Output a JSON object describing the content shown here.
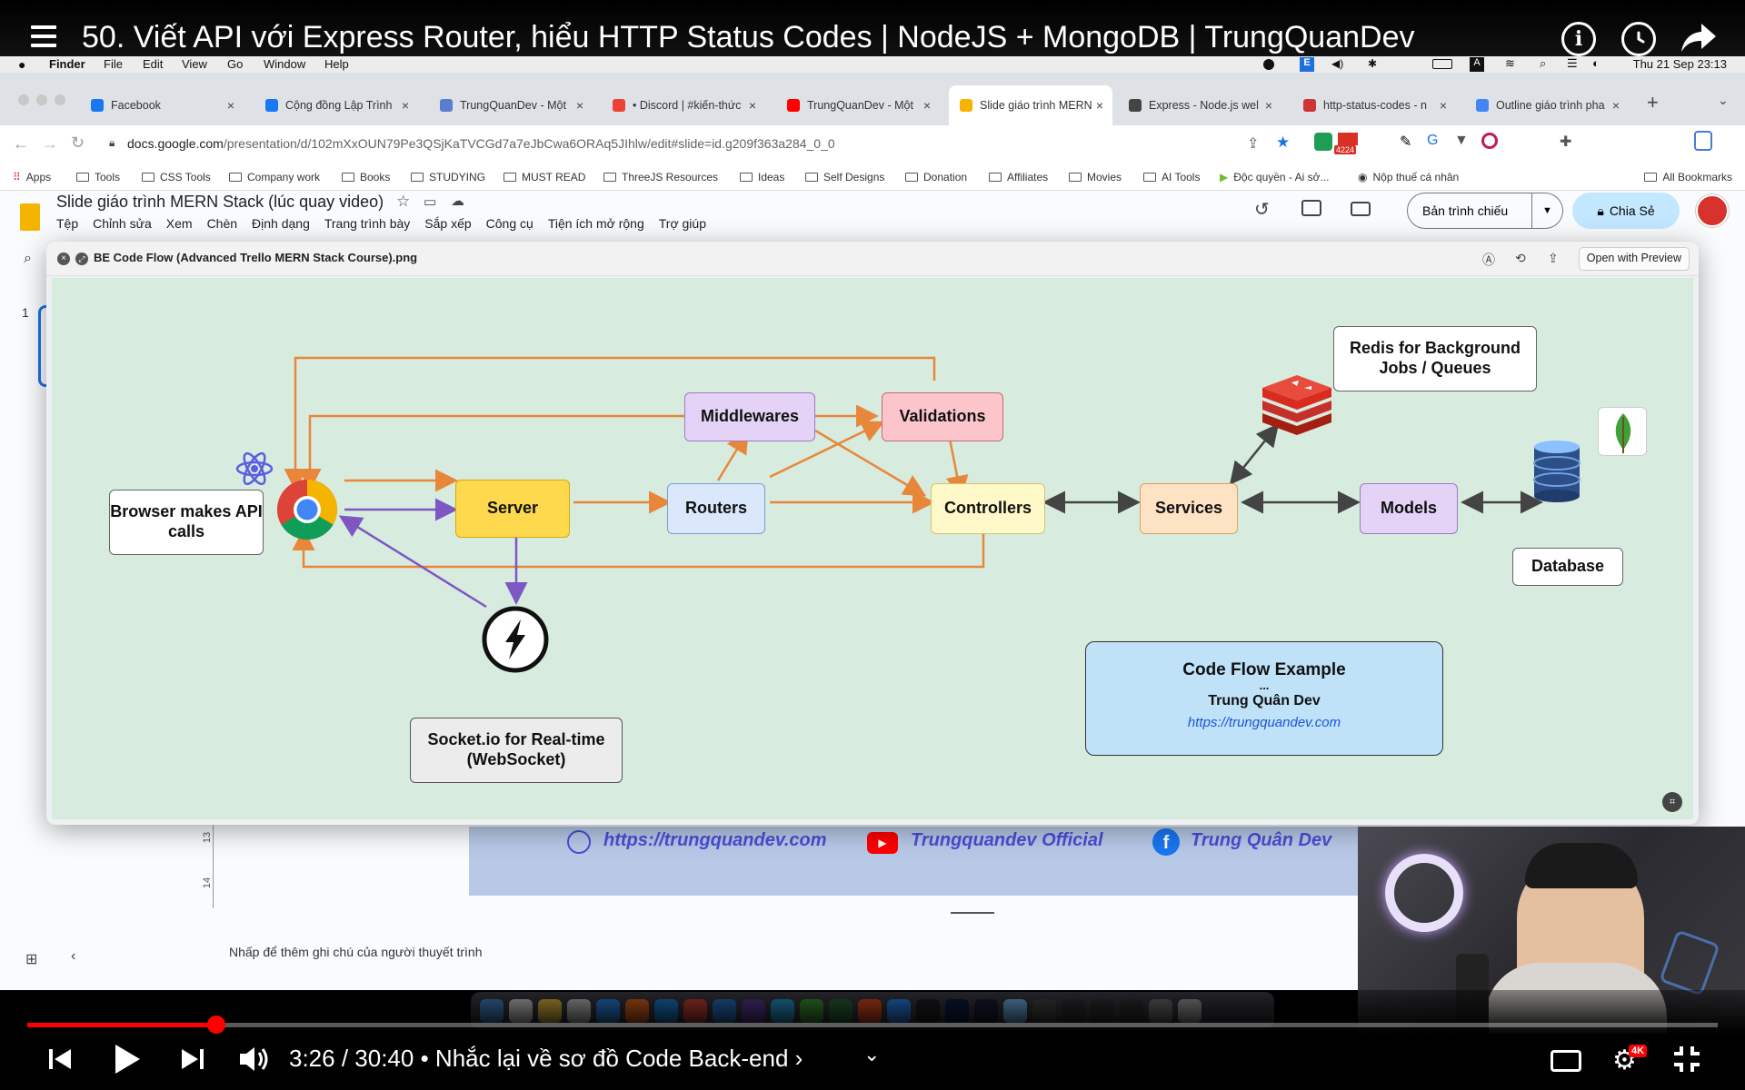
{
  "youtube": {
    "video_title": "50. Viết API với Express Router, hiểu HTTP Status Codes | NodeJS + MongoDB | TrungQuanDev",
    "time_current": "3:26",
    "time_total": "30:40",
    "chapter": "Nhắc lại về sơ đồ Code Back-end",
    "progress": 0.112,
    "quality_badge": "4K"
  },
  "mac_menubar": {
    "app": "Finder",
    "items": [
      "File",
      "Edit",
      "View",
      "Go",
      "Window",
      "Help"
    ],
    "clock": "Thu 21 Sep  23:13"
  },
  "browser": {
    "tabs": [
      {
        "label": "Facebook",
        "color": "#1877f2"
      },
      {
        "label": "Cộng đồng Lập Trình",
        "color": "#1877f2"
      },
      {
        "label": "TrungQuanDev - Một",
        "color": "#5b7ccf"
      },
      {
        "label": "• Discord | #kiến-thức",
        "color": "#ea4335"
      },
      {
        "label": "TrungQuanDev - Một",
        "color": "#ff0000"
      },
      {
        "label": "Slide giáo trình MERN",
        "color": "#f4b400",
        "active": true
      },
      {
        "label": "Express - Node.js wel",
        "color": "#444444"
      },
      {
        "label": "http-status-codes - n",
        "color": "#cc3534"
      },
      {
        "label": "Outline giáo trình pha",
        "color": "#4285f4"
      }
    ],
    "url_host": "docs.google.com",
    "url_path": "/presentation/d/102mXxOUN79Pe3QSjKaTVCGd7a7eJbCwa6ORAq5JIhlw/edit#slide=id.g209f363a284_0_0",
    "extension_badge": "4224",
    "bookmarks": [
      "Apps",
      "Tools",
      "CSS Tools",
      "Company work",
      "Books",
      "STUDYING",
      "MUST READ",
      "ThreeJS Resources",
      "Ideas",
      "Self Designs",
      "Donation",
      "Affiliates",
      "Movies",
      "AI Tools",
      "Độc quyền - Ai sở...",
      "Nộp thuế cá nhân"
    ],
    "all_bookmarks": "All Bookmarks"
  },
  "slides": {
    "doc_title": "Slide giáo trình MERN Stack (lúc quay video)",
    "menu": [
      "Tệp",
      "Chỉnh sửa",
      "Xem",
      "Chèn",
      "Định dạng",
      "Trang trình bày",
      "Sắp xếp",
      "Công cụ",
      "Tiện ích mở rộng",
      "Trợ giúp"
    ],
    "present_label": "Bản trình chiếu",
    "share_label": "Chia Sẻ",
    "slide_number": "1",
    "ruler_marks": [
      "13",
      "14"
    ],
    "footer_links": [
      "https://trungquandev.com",
      "Trungquandev Official",
      "Trung Quân Dev"
    ],
    "notes_placeholder": "Nhấp để thêm ghi chú của người thuyết trình"
  },
  "quicklook": {
    "filename": "BE Code Flow (Advanced Trello MERN Stack Course).png",
    "open_label": "Open with Preview"
  },
  "diagram": {
    "browser": "Browser makes API calls",
    "server": "Server",
    "routers": "Routers",
    "middlewares": "Middlewares",
    "validations": "Validations",
    "controllers": "Controllers",
    "services": "Services",
    "models": "Models",
    "database": "Database",
    "redis": "Redis for Background Jobs / Queues",
    "socket": "Socket.io for Real-time (WebSocket)",
    "card_title": "Code Flow Example",
    "card_dots": "...",
    "card_author": "Trung Quân Dev",
    "card_link": "https://trungquandev.com",
    "arrow_color": "#e8873a",
    "socket_arrow_color": "#7e57c2",
    "bidir_color": "#444444"
  }
}
